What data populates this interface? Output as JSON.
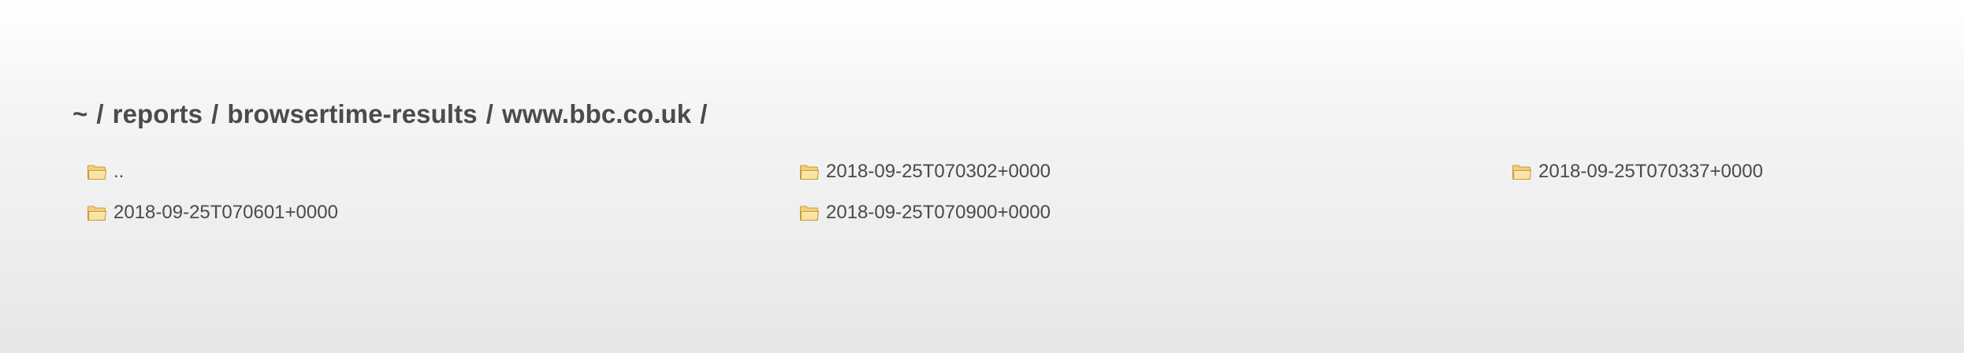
{
  "breadcrumb": {
    "segments": [
      "~",
      "reports",
      "browsertime-results",
      "www.bbc.co.uk"
    ],
    "separator": "/"
  },
  "entries": [
    {
      "name": "..",
      "icon": "folder-icon"
    },
    {
      "name": "2018-09-25T070302+0000",
      "icon": "folder-icon"
    },
    {
      "name": "2018-09-25T070337+0000",
      "icon": "folder-icon"
    },
    {
      "name": "2018-09-25T070601+0000",
      "icon": "folder-icon"
    },
    {
      "name": "2018-09-25T070900+0000",
      "icon": "folder-icon"
    }
  ],
  "colors": {
    "text": "#4a4a4a",
    "folder_fill": "#f6d27a",
    "folder_stroke": "#c99a3a"
  }
}
